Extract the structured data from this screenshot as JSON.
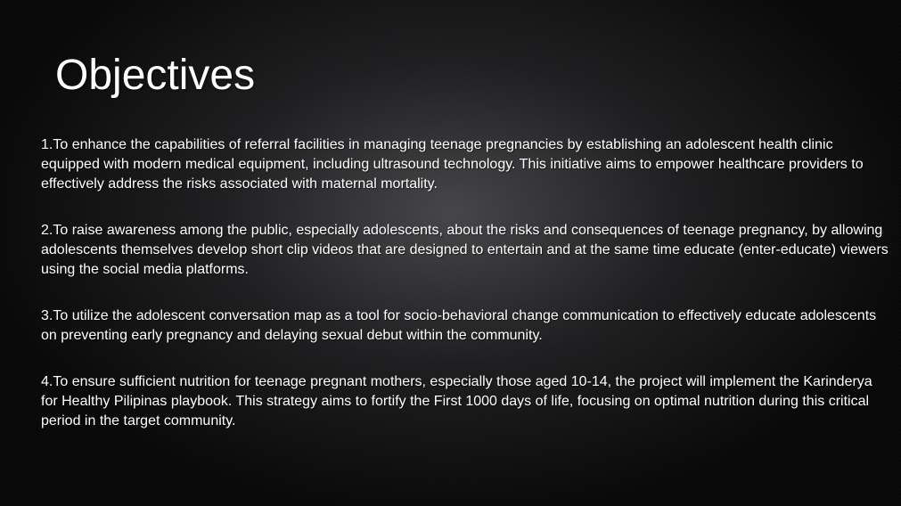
{
  "slide": {
    "title": "Objectives",
    "objectives": [
      "1.To enhance the capabilities of referral facilities in managing teenage pregnancies by establishing an adolescent health clinic equipped with modern medical equipment, including ultrasound technology. This initiative aims to empower healthcare providers to effectively address the risks associated with maternal mortality.",
      "2.To raise awareness among the public, especially adolescents, about the risks and consequences of teenage pregnancy, by allowing adolescents themselves develop short clip videos that are designed to entertain and at the same time educate (enter-educate) viewers using the social media platforms.",
      "3.To utilize the adolescent conversation map as a tool for socio-behavioral change communication to effectively educate adolescents on preventing early pregnancy and delaying sexual debut within the community.",
      "4.To ensure sufficient nutrition for teenage pregnant mothers, especially those aged 10-14, the project will implement the Karinderya for Healthy Pilipinas playbook. This strategy aims to fortify the First 1000 days of life, focusing on optimal nutrition during this critical period in the target community."
    ]
  },
  "colors": {
    "background": "#0c0b0c",
    "text": "#ffffff"
  }
}
